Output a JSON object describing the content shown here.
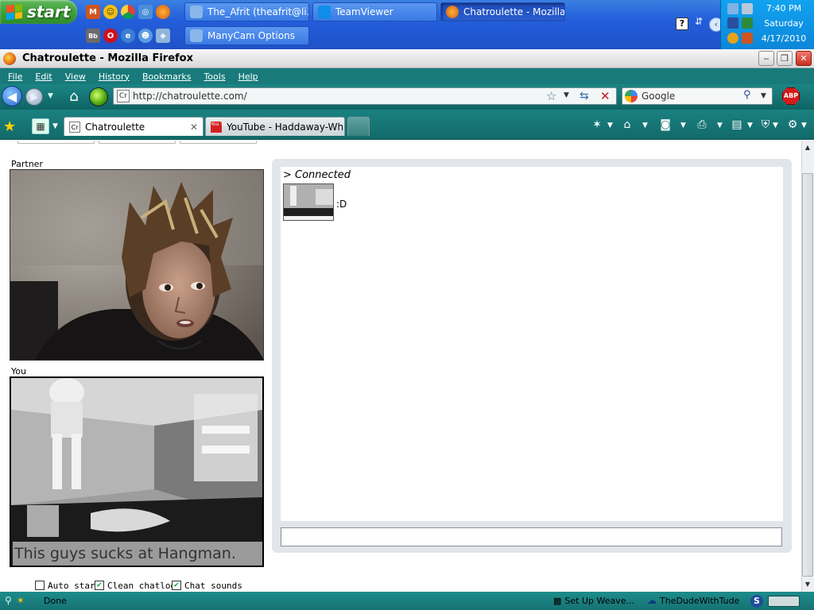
{
  "taskbar": {
    "start_label": "start",
    "windows": [
      {
        "label": "The_Afrit (theafrit@li..."
      },
      {
        "label": "TeamViewer"
      },
      {
        "label": "Chatroulette - Mozilla..."
      },
      {
        "label": "ManyCam Options"
      }
    ],
    "tray": {
      "time": "7:40 PM",
      "day": "Saturday",
      "date": "4/17/2010"
    },
    "help_icon_label": "?"
  },
  "window": {
    "title": "Chatroulette - Mozilla Firefox"
  },
  "menu": [
    "File",
    "Edit",
    "View",
    "History",
    "Bookmarks",
    "Tools",
    "Help"
  ],
  "navigation": {
    "url": "http://chatroulette.com/",
    "url_favicon": "Cr",
    "search_placeholder": "Google",
    "abp_label": "ABP"
  },
  "tabs": [
    {
      "favicon": "Cr",
      "label": "Chatroulette",
      "active": true
    },
    {
      "favicon": "You Tube",
      "label": "YouTube - Haddaway-Wh...",
      "active": false
    }
  ],
  "page": {
    "partner_label": "Partner",
    "you_label": "You",
    "overlay_text": "This guys sucks at Hangman.",
    "chat": {
      "connected": "> Connected",
      "message": ":D"
    },
    "options": [
      {
        "label": "Auto start",
        "checked": false
      },
      {
        "label": "Clean chatlog",
        "checked": true
      },
      {
        "label": "Chat sounds",
        "checked": true
      }
    ]
  },
  "status": {
    "text": "Done",
    "weave_label": "Set Up Weave...",
    "user_label": "TheDudeWithTude",
    "s_label": "S"
  },
  "colors": {
    "firefox_theme": "#187a7a",
    "xp_taskbar": "#245edb",
    "start_green": "#3a9c35",
    "chat_panel": "#e2e6ea"
  }
}
